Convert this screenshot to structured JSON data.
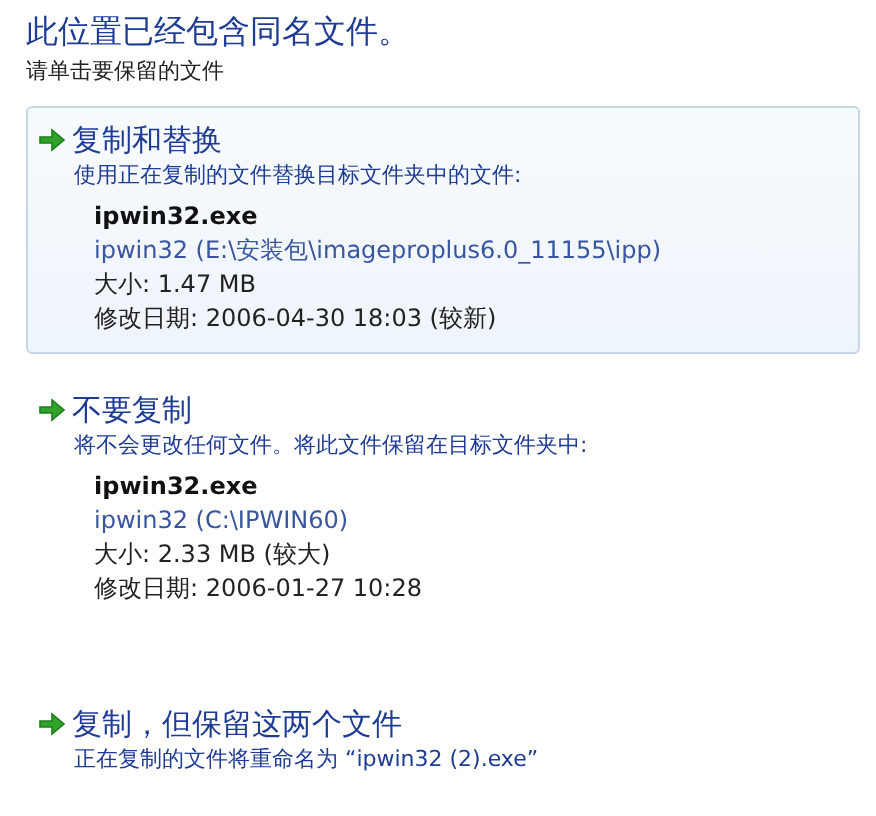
{
  "heading": "此位置已经包含同名文件。",
  "instruction": "请单击要保留的文件",
  "options": [
    {
      "title": "复制和替换",
      "description": "使用正在复制的文件替换目标文件夹中的文件:",
      "selected": true,
      "file": {
        "name": "ipwin32.exe",
        "location": "ipwin32 (E:\\安装包\\imageproplus6.0_11155\\ipp)",
        "size": "大小: 1.47 MB",
        "modified": "修改日期: 2006-04-30  18:03 (较新)"
      }
    },
    {
      "title": "不要复制",
      "description": "将不会更改任何文件。将此文件保留在目标文件夹中:",
      "selected": false,
      "file": {
        "name": "ipwin32.exe",
        "location": "ipwin32 (C:\\IPWIN60)",
        "size": "大小: 2.33 MB (较大)",
        "modified": "修改日期: 2006-01-27  10:28"
      }
    },
    {
      "title": "复制，但保留这两个文件",
      "description": "正在复制的文件将重命名为 “ipwin32 (2).exe”",
      "selected": false
    }
  ]
}
